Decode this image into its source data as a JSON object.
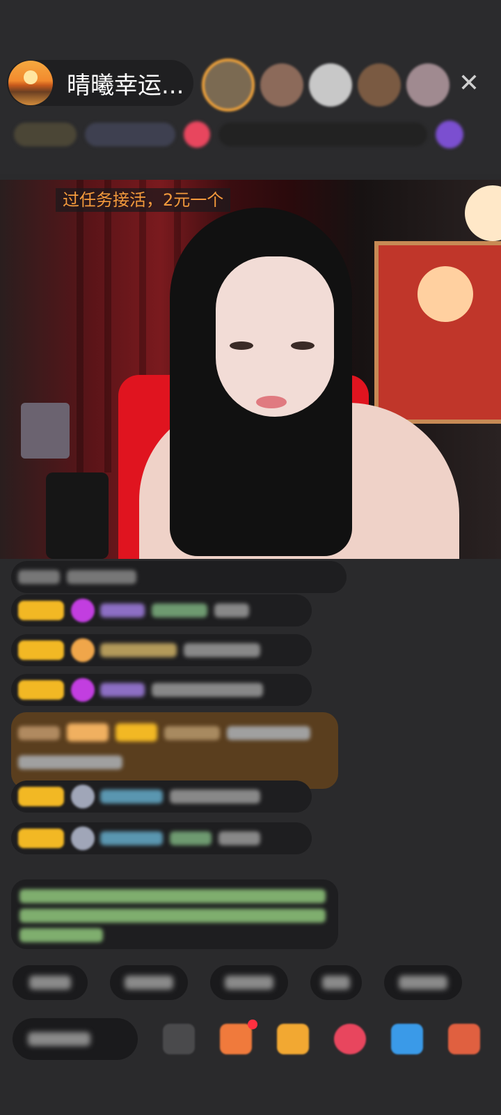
{
  "header": {
    "host_name": "晴曦幸运..."
  },
  "video": {
    "caption": "过任务接活，2元一个"
  },
  "icons": {
    "close": "close-icon",
    "host_avatar": "avatar",
    "chat": "chat-icon",
    "gift": "gift-icon",
    "shop": "shop-icon",
    "game": "game-icon",
    "more": "more-icon"
  },
  "colors": {
    "caption_text": "#f49a3c",
    "badge_gold": "#f2b824",
    "background": "#2a2a2c"
  }
}
